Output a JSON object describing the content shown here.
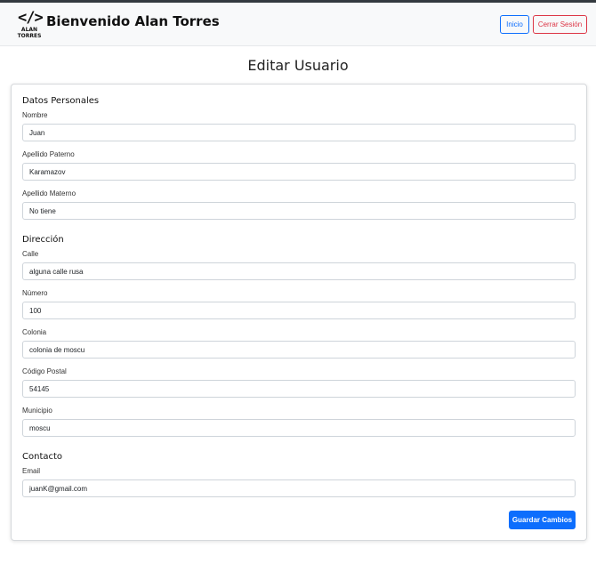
{
  "navbar": {
    "logo": {
      "code_glyph": "</>",
      "line1": "ALAN",
      "line2": "TORRES"
    },
    "welcome": "Bienvenido Alan Torres",
    "home_label": "Inicio",
    "logout_label": "Cerrar Sesión",
    "colors": {
      "home": "#0d6efd",
      "logout": "#dc3545"
    }
  },
  "page": {
    "title": "Editar Usuario"
  },
  "sections": {
    "personal": {
      "title": "Datos Personales",
      "nombre": {
        "label": "Nombre",
        "value": "Juan"
      },
      "apellido_paterno": {
        "label": "Apellido Paterno",
        "value": "Karamazov"
      },
      "apellido_materno": {
        "label": "Apellido Materno",
        "value": "No tiene"
      }
    },
    "address": {
      "title": "Dirección",
      "calle": {
        "label": "Calle",
        "value": "alguna calle rusa"
      },
      "numero": {
        "label": "Número",
        "value": "100"
      },
      "colonia": {
        "label": "Colonia",
        "value": "colonia de moscu"
      },
      "codigo_postal": {
        "label": "Código Postal",
        "value": "54145"
      },
      "municipio": {
        "label": "Municipio",
        "value": "moscu"
      }
    },
    "contact": {
      "title": "Contacto",
      "email": {
        "label": "Email",
        "value": "juanK@gmail.com"
      }
    }
  },
  "actions": {
    "save_label": "Guardar Cambios",
    "save_color": "#0d6efd"
  }
}
